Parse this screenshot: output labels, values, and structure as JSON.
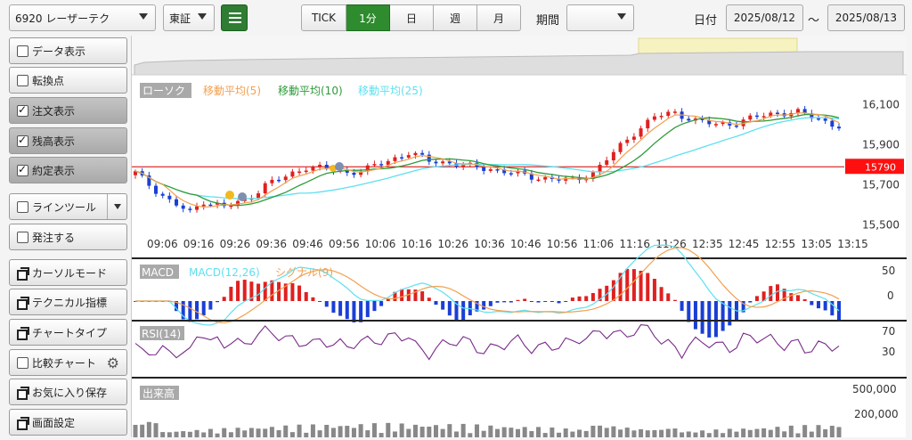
{
  "symbol_select": "6920 レーザーテク",
  "market_select": "東証",
  "timeframe_tabs": [
    "TICK",
    "1分",
    "日",
    "週",
    "月"
  ],
  "active_tab": "1分",
  "period_label": "期間",
  "period_value": "",
  "date_label": "日付",
  "date_from": "2025/08/12",
  "date_sep": "～",
  "date_to": "2025/08/13",
  "side_buttons": [
    {
      "label": "データ表示",
      "kind": "checkbox",
      "checked": false
    },
    {
      "label": "転換点",
      "kind": "checkbox",
      "checked": false
    },
    {
      "label": "注文表示",
      "kind": "checkbox",
      "checked": true
    },
    {
      "label": "残高表示",
      "kind": "checkbox",
      "checked": true
    },
    {
      "label": "約定表示",
      "kind": "checkbox",
      "checked": true
    },
    {
      "label": "ラインツール",
      "kind": "checkbox",
      "checked": false
    },
    {
      "label": "発注する",
      "kind": "checkbox",
      "checked": false
    },
    {
      "label": "カーソルモード",
      "kind": "window"
    },
    {
      "label": "テクニカル指標",
      "kind": "window"
    },
    {
      "label": "チャートタイプ",
      "kind": "window"
    },
    {
      "label": "比較チャート",
      "kind": "checkbox",
      "checked": false
    },
    {
      "label": "お気に入り保存",
      "kind": "window"
    },
    {
      "label": "画面設定",
      "kind": "window"
    }
  ],
  "colors": {
    "up": "#e02020",
    "down": "#1a3fd6",
    "ma5": "#f2a050",
    "ma10": "#2e9a3a",
    "ma25": "#5ee0ef",
    "accent": "#2e8b2e",
    "rsi": "#7a2a8a",
    "price_line": "#d40000"
  },
  "chart_data": [
    {
      "type": "candlestick",
      "legend": [
        "ローソク",
        "移動平均(5)",
        "移動平均(10)",
        "移動平均(25)"
      ],
      "y_ticks": [
        "16,100",
        "15,900",
        "15,700",
        "15,500"
      ],
      "y_tick_values": [
        16100,
        15900,
        15700,
        15500
      ],
      "ylim": [
        15400,
        16200
      ],
      "current_price_label": "15790",
      "current_price": 15790,
      "x_ticks": [
        "09:06",
        "09:16",
        "09:26",
        "09:36",
        "09:46",
        "09:56",
        "10:06",
        "10:16",
        "10:26",
        "10:36",
        "10:46",
        "10:56",
        "11:06",
        "11:16",
        "11:26",
        "12:35",
        "12:45",
        "12:55",
        "13:05",
        "13:15"
      ],
      "close_path": [
        [
          0,
          15760
        ],
        [
          2,
          15700
        ],
        [
          5,
          15620
        ],
        [
          8,
          15560
        ],
        [
          10,
          15620
        ],
        [
          13,
          15590
        ],
        [
          16,
          15620
        ],
        [
          19,
          15700
        ],
        [
          22,
          15740
        ],
        [
          25,
          15790
        ],
        [
          28,
          15780
        ],
        [
          31,
          15760
        ],
        [
          34,
          15780
        ],
        [
          37,
          15820
        ],
        [
          40,
          15860
        ],
        [
          43,
          15820
        ],
        [
          46,
          15810
        ],
        [
          49,
          15790
        ],
        [
          52,
          15780
        ],
        [
          55,
          15760
        ],
        [
          58,
          15740
        ],
        [
          61,
          15730
        ],
        [
          64,
          15720
        ],
        [
          67,
          15760
        ],
        [
          70,
          15860
        ],
        [
          73,
          15960
        ],
        [
          76,
          16040
        ],
        [
          79,
          16060
        ],
        [
          82,
          16020
        ],
        [
          85,
          16000
        ],
        [
          88,
          16010
        ],
        [
          91,
          16040
        ],
        [
          94,
          16060
        ],
        [
          97,
          16060
        ],
        [
          100,
          16030
        ],
        [
          103,
          15990
        ]
      ]
    },
    {
      "type": "line",
      "name": "MACD",
      "legend": [
        "MACD",
        "MACD(12,26)",
        "シグナル(9)"
      ],
      "y_ticks": [
        "50",
        "0"
      ]
    },
    {
      "type": "line",
      "name": "RSI",
      "legend": [
        "RSI(14)"
      ],
      "y_ticks": [
        "70",
        "30"
      ]
    },
    {
      "type": "bar",
      "name": "出来高",
      "legend": [
        "出来高"
      ],
      "y_ticks": [
        "500,000",
        "200,000"
      ]
    }
  ]
}
